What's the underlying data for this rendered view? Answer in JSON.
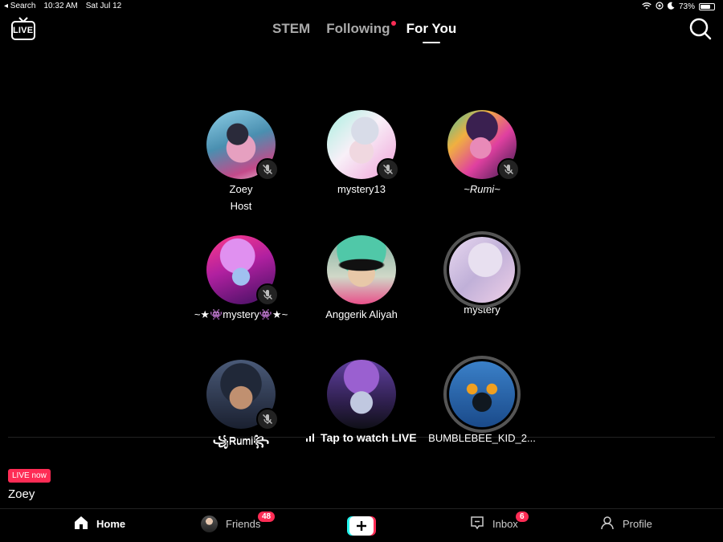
{
  "status": {
    "back": "◂ Search",
    "time": "10:32 AM",
    "date": "Sat Jul 12",
    "battery": "73%",
    "battery_level": 0.73
  },
  "tabs": [
    {
      "label": "STEM"
    },
    {
      "label": "Following"
    },
    {
      "label": "For You"
    }
  ],
  "live_label": "LIVE",
  "grid": [
    {
      "name": "Zoey",
      "sub": "Host"
    },
    {
      "name": "mystery13"
    },
    {
      "name": "~Rumi~"
    },
    {
      "name": "~★👾mystery👾★~"
    },
    {
      "name": "Anggerik Aliyah"
    },
    {
      "name": "mystery"
    },
    {
      "name": "꧁Rumi꧂"
    },
    {
      "name": "BUMBLEBEE_KID_2..."
    }
  ],
  "tap_to_watch": "Tap to watch LIVE",
  "live_now": "LIVE now",
  "host": "Zoey",
  "nav": {
    "home": "Home",
    "friends": "Friends",
    "friends_badge": "48",
    "inbox": "Inbox",
    "inbox_badge": "6",
    "profile": "Profile"
  },
  "colors": {
    "accent": "#fe2c55",
    "background": "#000000"
  }
}
